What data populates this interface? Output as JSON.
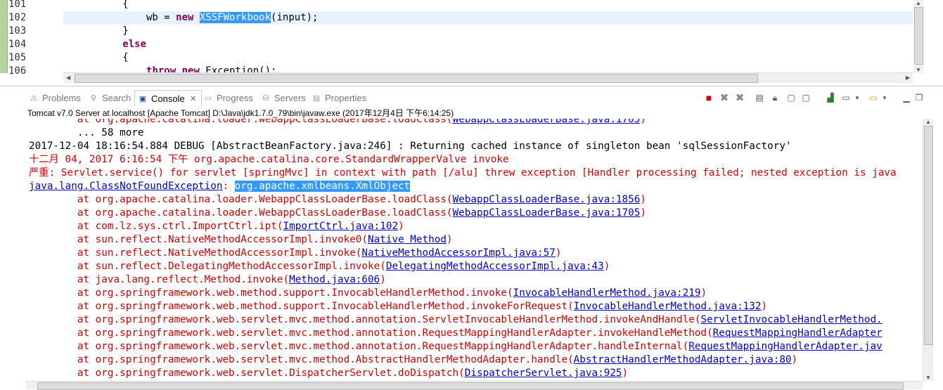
{
  "editor": {
    "line_numbers": [
      "101",
      "102",
      "103",
      "104",
      "105",
      "106"
    ],
    "lines": [
      {
        "pre": "          {",
        "kw": "",
        "mid": "",
        "sel": "",
        "post": ""
      },
      {
        "pre": "              wb = ",
        "kw": "new",
        "mid": " ",
        "sel": "XSSFWorkbook",
        "post": "(input);"
      },
      {
        "pre": "          }",
        "kw": "",
        "mid": "",
        "sel": "",
        "post": ""
      },
      {
        "pre": "          ",
        "kw": "else",
        "mid": "",
        "sel": "",
        "post": ""
      },
      {
        "pre": "          {",
        "kw": "",
        "mid": "",
        "sel": "",
        "post": ""
      },
      {
        "pre": "              ",
        "kw": "throw new",
        "mid": " Exception();",
        "sel": "",
        "post": ""
      }
    ]
  },
  "tabs": [
    {
      "label": "Problems",
      "icon": "problems-icon",
      "active": false
    },
    {
      "label": "Search",
      "icon": "search-icon",
      "active": false
    },
    {
      "label": "Console",
      "icon": "console-icon",
      "active": true
    },
    {
      "label": "Progress",
      "icon": "progress-icon",
      "active": false
    },
    {
      "label": "Servers",
      "icon": "servers-icon",
      "active": false
    },
    {
      "label": "Properties",
      "icon": "properties-icon",
      "active": false
    }
  ],
  "console": {
    "title": "Tomcat v7.0 Server at localhost [Apache Tomcat] D:\\Java\\jdk1.7.0_79\\bin\\javaw.exe (2017年12月4日 下午6:14:25)",
    "lines": [
      {
        "color": "red",
        "text": "        at org.apache.catalina.loader.WebappClassLoaderBase.loadClass(",
        "link": "WebappClassLoaderBase.java:1705",
        "tail": ")"
      },
      {
        "color": "blk",
        "text": "        ... 58 more",
        "link": "",
        "tail": ""
      },
      {
        "color": "blk",
        "text": "2017-12-04 18:16:54.884 DEBUG [AbstractBeanFactory.java:246] : Returning cached instance of singleton bean 'sqlSessionFactory'",
        "link": "",
        "tail": ""
      },
      {
        "color": "red",
        "text": "十二月 04, 2017 6:16:54 下午 org.apache.catalina.core.StandardWrapperValve invoke",
        "link": "",
        "tail": ""
      },
      {
        "color": "red",
        "text": "严重: Servlet.service() for servlet [springMvc] in context with path [/alu] threw exception [Handler processing failed; nested exception is java",
        "link": "",
        "tail": ""
      },
      {
        "color": "red",
        "text": "",
        "link": "java.lang.ClassNotFoundException",
        "tail": ": ",
        "hl": "org.apache.xmlbeans.XmlObject"
      },
      {
        "color": "red",
        "text": "        at org.apache.catalina.loader.WebappClassLoaderBase.loadClass(",
        "link": "WebappClassLoaderBase.java:1856",
        "tail": ")"
      },
      {
        "color": "red",
        "text": "        at org.apache.catalina.loader.WebappClassLoaderBase.loadClass(",
        "link": "WebappClassLoaderBase.java:1705",
        "tail": ")"
      },
      {
        "color": "red",
        "text": "        at com.lz.sys.ctrl.ImportCtrl.ipt(",
        "link": "ImportCtrl.java:102",
        "tail": ")"
      },
      {
        "color": "red",
        "text": "        at sun.reflect.NativeMethodAccessorImpl.invoke0(",
        "link": "Native Method",
        "tail": ")"
      },
      {
        "color": "red",
        "text": "        at sun.reflect.NativeMethodAccessorImpl.invoke(",
        "link": "NativeMethodAccessorImpl.java:57",
        "tail": ")"
      },
      {
        "color": "red",
        "text": "        at sun.reflect.DelegatingMethodAccessorImpl.invoke(",
        "link": "DelegatingMethodAccessorImpl.java:43",
        "tail": ")"
      },
      {
        "color": "red",
        "text": "        at java.lang.reflect.Method.invoke(",
        "link": "Method.java:606",
        "tail": ")"
      },
      {
        "color": "red",
        "text": "        at org.springframework.web.method.support.InvocableHandlerMethod.invoke(",
        "link": "InvocableHandlerMethod.java:219",
        "tail": ")"
      },
      {
        "color": "red",
        "text": "        at org.springframework.web.method.support.InvocableHandlerMethod.invokeForRequest(",
        "link": "InvocableHandlerMethod.java:132",
        "tail": ")"
      },
      {
        "color": "red",
        "text": "        at org.springframework.web.servlet.mvc.method.annotation.ServletInvocableHandlerMethod.invokeAndHandle(",
        "link": "ServletInvocableHandlerMethod.",
        "tail": ""
      },
      {
        "color": "red",
        "text": "        at org.springframework.web.servlet.mvc.method.annotation.RequestMappingHandlerAdapter.invokeHandleMethod(",
        "link": "RequestMappingHandlerAdapter",
        "tail": ""
      },
      {
        "color": "red",
        "text": "        at org.springframework.web.servlet.mvc.method.annotation.RequestMappingHandlerAdapter.handleInternal(",
        "link": "RequestMappingHandlerAdapter.jav",
        "tail": ""
      },
      {
        "color": "red",
        "text": "        at org.springframework.web.servlet.mvc.method.AbstractHandlerMethodAdapter.handle(",
        "link": "AbstractHandlerMethodAdapter.java:80",
        "tail": ")"
      },
      {
        "color": "red",
        "text": "        at org.springframework.web.servlet.DispatcherServlet.doDispatch(",
        "link": "DispatcherServlet.java:925",
        "tail": ")"
      }
    ]
  },
  "colors": {
    "error": "#d00000",
    "link": "#0000cc",
    "selection": "#3399ff",
    "keyword": "#7f0055"
  }
}
